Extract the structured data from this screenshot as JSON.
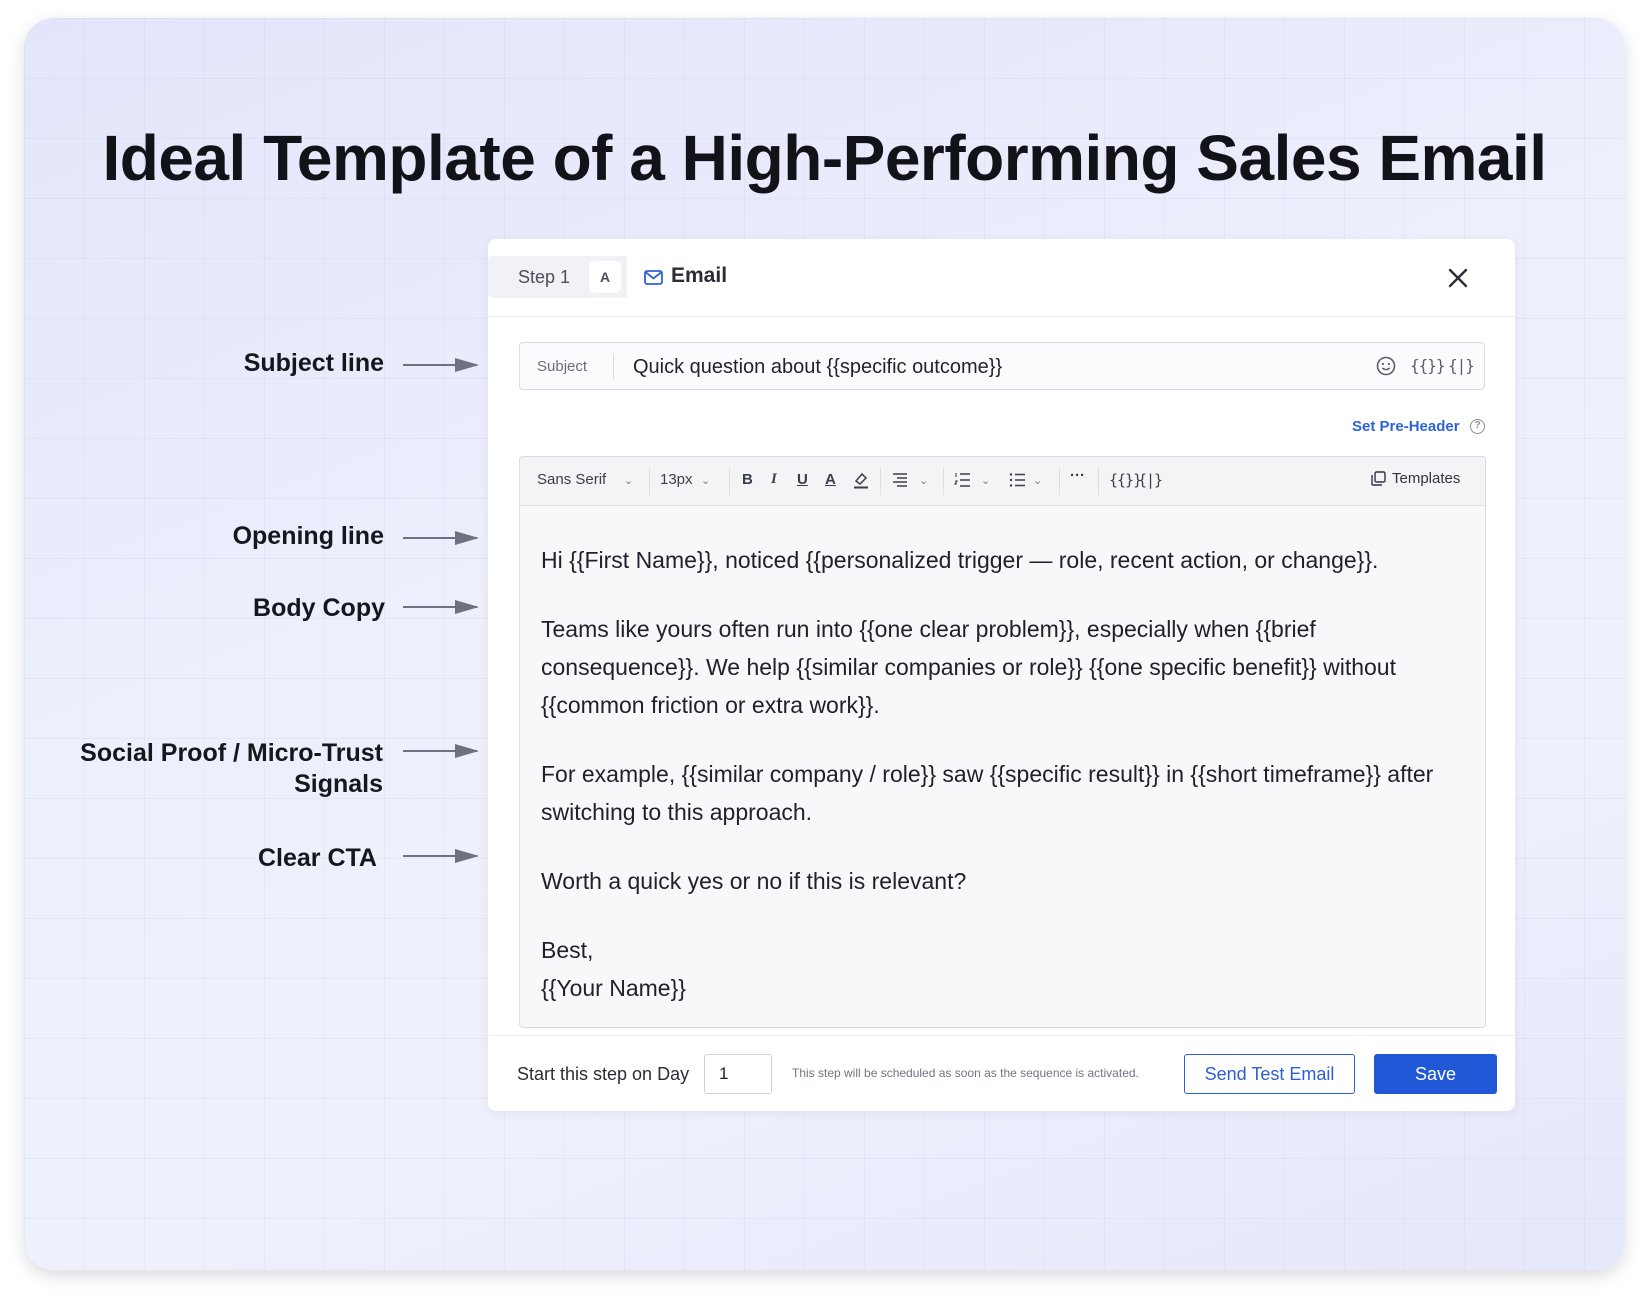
{
  "title": "Ideal Template of a High-Performing Sales Email",
  "annotations": {
    "subject": "Subject line",
    "opening": "Opening line",
    "body": "Body Copy",
    "social_line1": "Social Proof / Micro-Trust",
    "social_line2": "Signals",
    "cta": "Clear CTA"
  },
  "header": {
    "step_label": "Step 1",
    "step_badge": "A",
    "channel_label": "Email"
  },
  "subject": {
    "label": "Subject",
    "value": "Quick question about {{specific outcome}}",
    "icons": [
      "smile-icon",
      "variable-icon",
      "snippet-icon"
    ]
  },
  "preheader_link": "Set Pre-Header",
  "toolbar": {
    "font": "Sans Serif",
    "size": "13px",
    "bold": "B",
    "italic": "I",
    "underline": "U",
    "text_color": "A",
    "templates": "Templates"
  },
  "body": {
    "opening": "Hi {{First Name}}, noticed {{personalized trigger — role, recent action, or change}}.",
    "copy": "Teams like yours often run into {{one clear problem}}, especially when {{brief consequence}}. We help {{similar companies or role}} {{one specific benefit}} without {{common friction or extra work}}.",
    "social_proof": "For example, {{similar company / role}} saw {{specific result}} in {{short timeframe}} after switching to this approach.",
    "cta": "Worth a quick yes or no if this is relevant?",
    "signoff": "Best,",
    "signature": "{{Your Name}}"
  },
  "footer": {
    "start_label": "Start this step on Day",
    "day_value": "1",
    "schedule_note": "This step will be scheduled as soon as the sequence is activated.",
    "send_test": "Send Test Email",
    "save": "Save"
  },
  "colors": {
    "accent": "#2158d8",
    "link": "#2d63d6",
    "background": "#eceefc"
  }
}
